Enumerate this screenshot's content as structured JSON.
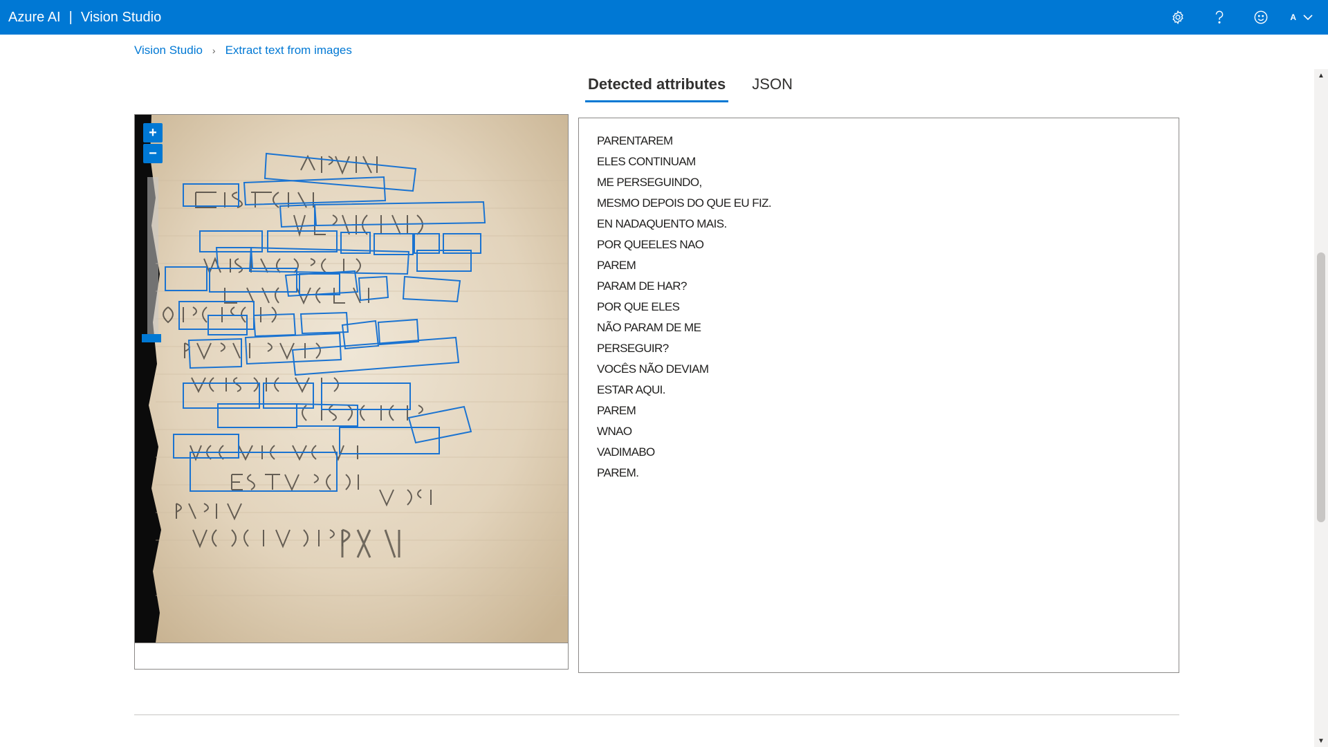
{
  "header": {
    "brand_primary": "Azure AI",
    "brand_separator": "|",
    "brand_secondary": "Vision Studio",
    "account_initial": "A"
  },
  "breadcrumb": {
    "home": "Vision Studio",
    "chevron": "›",
    "current": "Extract text from images"
  },
  "tabs": [
    {
      "label": "Detected attributes",
      "active": true
    },
    {
      "label": "JSON",
      "active": false
    }
  ],
  "image_viewer": {
    "zoom_in": "+",
    "zoom_out": "−"
  },
  "results": {
    "lines": [
      "PARENTAREM",
      "ELES CONTINUAM",
      "ME PERSEGUINDO,",
      "MESMO DEPOIS DO QUE EU FIZ.",
      "EN NADAQUENTO MAIS.",
      "POR QUEELES NAO",
      "PAREM",
      "PARAM DE HAR?",
      "POR QUE ELES",
      "NÃO PARAM DE ME",
      "PERSEGUIR?",
      "VOCÊS NÃO DEVIAM",
      "ESTAR AQUI.",
      "PAREM",
      "WNAO",
      "VADIMABO",
      "PAREM."
    ]
  },
  "colors": {
    "accent": "#0078d4",
    "box_stroke": "#1a73d1",
    "paper": "#e7dccb"
  }
}
